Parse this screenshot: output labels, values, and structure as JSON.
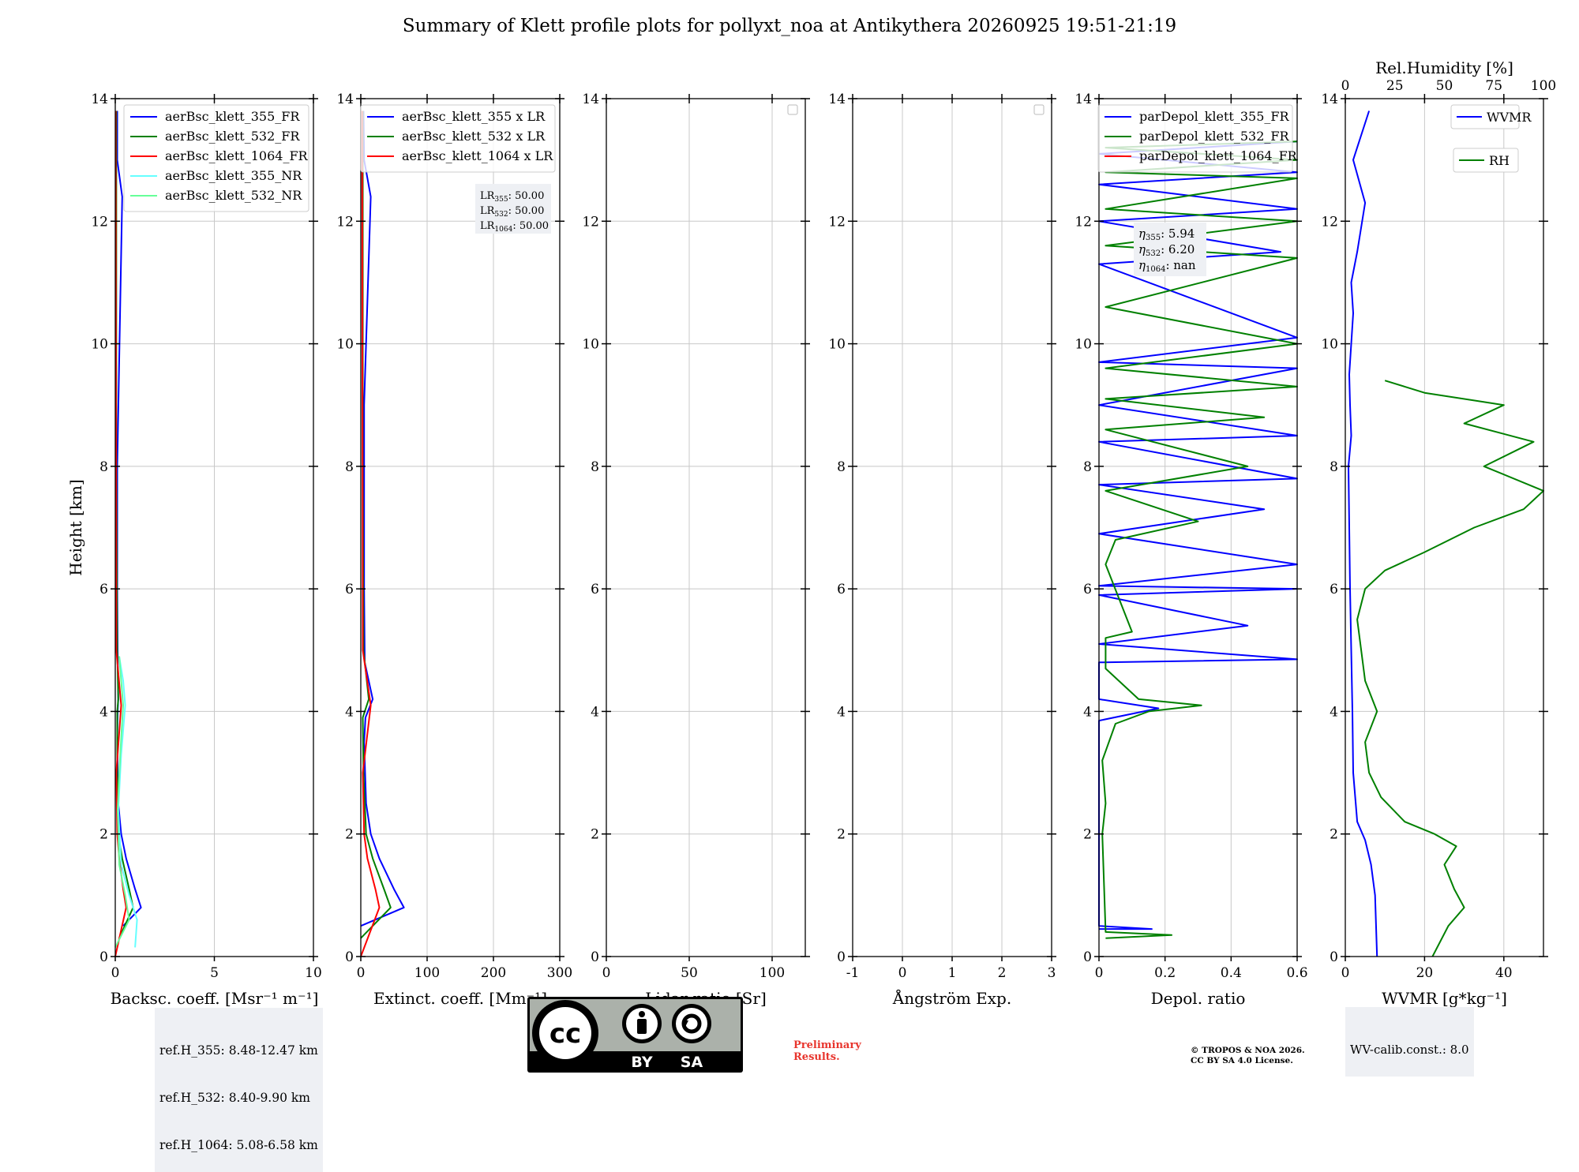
{
  "title": "Summary of Klett profile plots for pollyxt_noa at Antikythera 20260925 19:51-21:19",
  "colors": {
    "blue": "#0000ff",
    "green": "#008000",
    "red": "#ff0000",
    "cyan": "#66ffff",
    "lightgreen": "#66ff99",
    "prelim": "#e8352d"
  },
  "ref_box": [
    "ref.H_355: 8.48-12.47 km",
    "ref.H_532: 8.40-9.90 km",
    "ref.H_1064: 5.08-6.58 km"
  ],
  "lr_box": [
    "LR355: 50.00",
    "LR532: 50.00",
    "LR1064: 50.00"
  ],
  "eta_box": [
    "η355: 5.94",
    "η532: 6.20",
    "η1064: nan"
  ],
  "wv_calib": "WV-calib.const.: 8.0",
  "preliminary": [
    "Preliminary",
    "Results."
  ],
  "copyright": [
    "© TROPOS & NOA 2026.",
    "CC BY SA 4.0 License."
  ],
  "cc_logo": {
    "icons": [
      "cc-icon",
      "by-icon",
      "sa-icon"
    ],
    "labels": [
      "BY",
      "SA"
    ]
  },
  "chart_data": [
    {
      "type": "line",
      "id": "backscatter",
      "xlabel": "Backsc. coeff. [Msr⁻¹ m⁻¹]",
      "ylabel": "Height [km]",
      "xlim": [
        0,
        10
      ],
      "ylim": [
        0,
        14
      ],
      "xticks": [
        0,
        5,
        10
      ],
      "yticks": [
        0,
        2,
        4,
        6,
        8,
        10,
        12,
        14
      ],
      "grid": true,
      "legend": "top-right",
      "series": [
        {
          "name": "aerBsc_klett_355_FR",
          "color": "blue",
          "x": [
            0.4,
            1.3,
            1.0,
            0.55,
            0.3,
            0.15,
            0.1,
            0.12,
            0.15,
            0.12,
            0.1,
            0.1,
            0.35,
            0.1,
            0.1
          ],
          "y": [
            0.5,
            0.8,
            1.1,
            1.6,
            2.0,
            2.5,
            3.5,
            4.0,
            4.2,
            5.0,
            6.0,
            8.0,
            12.4,
            13.0,
            13.8
          ]
        },
        {
          "name": "aerBsc_klett_532_FR",
          "color": "green",
          "x": [
            0.2,
            0.9,
            0.7,
            0.35,
            0.15,
            0.1,
            0.1,
            0.15,
            0.1,
            0.05,
            0.05
          ],
          "y": [
            0.3,
            0.8,
            1.1,
            1.6,
            2.0,
            3.0,
            4.0,
            4.2,
            5.0,
            8.0,
            13.8
          ]
        },
        {
          "name": "aerBsc_klett_1064_FR",
          "color": "red",
          "x": [
            0.0,
            0.55,
            0.4,
            0.2,
            0.1,
            0.05,
            0.3,
            0.05,
            0.02
          ],
          "y": [
            0.0,
            0.8,
            1.1,
            1.6,
            2.0,
            3.0,
            4.1,
            5.0,
            13.8
          ]
        },
        {
          "name": "aerBsc_klett_355_NR",
          "color": "cyan",
          "x": [
            1.0,
            1.1,
            0.7,
            0.3,
            0.15,
            0.3,
            0.5,
            0.4,
            0.2
          ],
          "y": [
            0.15,
            0.6,
            1.0,
            1.5,
            2.4,
            3.3,
            4.1,
            4.5,
            4.9
          ]
        },
        {
          "name": "aerBsc_klett_532_NR",
          "color": "lightgreen",
          "x": [
            0.0,
            0.7,
            0.5,
            0.2,
            0.12,
            0.25,
            0.4,
            0.2
          ],
          "y": [
            0.15,
            0.6,
            1.0,
            1.5,
            2.4,
            3.3,
            4.1,
            4.9
          ]
        }
      ]
    },
    {
      "type": "line",
      "id": "extinction",
      "xlabel": "Extinct. coeff. [Mm⁻¹]",
      "xlim": [
        0,
        300
      ],
      "ylim": [
        0,
        14
      ],
      "xticks": [
        0,
        100,
        200,
        300
      ],
      "yticks": [
        0,
        2,
        4,
        6,
        8,
        10,
        12,
        14
      ],
      "grid": true,
      "legend": "top-right",
      "series": [
        {
          "name": "aerBsc_klett_355 x LR",
          "color": "blue",
          "x": [
            0,
            65,
            50,
            28,
            15,
            8,
            5,
            7,
            18,
            6,
            5,
            5,
            15,
            5,
            4
          ],
          "y": [
            0.5,
            0.8,
            1.1,
            1.6,
            2.0,
            2.5,
            3.5,
            3.9,
            4.2,
            4.8,
            6.0,
            9.0,
            12.4,
            13.0,
            13.8
          ]
        },
        {
          "name": "aerBsc_klett_532 x LR",
          "color": "green",
          "x": [
            0,
            45,
            35,
            18,
            8,
            4,
            3,
            12,
            4,
            3,
            3
          ],
          "y": [
            0.3,
            0.8,
            1.1,
            1.6,
            2.0,
            3.0,
            3.9,
            4.2,
            5.0,
            8.0,
            13.8
          ]
        },
        {
          "name": "aerBsc_klett_1064 x LR",
          "color": "red",
          "x": [
            0,
            28,
            22,
            10,
            5,
            3,
            15,
            3,
            2
          ],
          "y": [
            0.0,
            0.8,
            1.1,
            1.6,
            2.0,
            3.0,
            4.1,
            5.0,
            13.8
          ]
        }
      ]
    },
    {
      "type": "line",
      "id": "lidar-ratio",
      "xlabel": "Lidar ratio [Sr]",
      "xlim": [
        0,
        120
      ],
      "ylim": [
        0,
        14
      ],
      "xticks": [
        0,
        50,
        100
      ],
      "yticks": [
        0,
        2,
        4,
        6,
        8,
        10,
        12,
        14
      ],
      "grid": true,
      "legend": "top-right",
      "series": []
    },
    {
      "type": "line",
      "id": "angstrom",
      "xlabel": "Ångström Exp.",
      "xlim": [
        -1,
        3
      ],
      "ylim": [
        0,
        14
      ],
      "xticks": [
        -1,
        0,
        1,
        2,
        3
      ],
      "yticks": [
        0,
        2,
        4,
        6,
        8,
        10,
        12,
        14
      ],
      "grid": true,
      "legend": "top-right",
      "series": []
    },
    {
      "type": "line",
      "id": "depol",
      "xlabel": "Depol. ratio",
      "xlim": [
        0,
        0.6
      ],
      "ylim": [
        0,
        14
      ],
      "xticks": [
        0,
        0.2,
        0.4,
        0.6
      ],
      "yticks": [
        0,
        2,
        4,
        6,
        8,
        10,
        12,
        14
      ],
      "grid": true,
      "legend": "top-right",
      "series": [
        {
          "name": "parDepol_klett_355_FR",
          "color": "blue",
          "x": [
            0.0,
            0.16,
            0.0,
            0.0,
            0.18,
            0.0,
            0.0,
            0.6,
            0.0,
            0.45,
            0.0,
            0.6,
            0.0,
            0.6,
            0.0,
            0.5,
            0.0,
            0.6,
            0.0,
            0.6,
            0.0,
            0.6,
            0.0,
            0.6,
            0.0,
            0.55,
            0.0,
            0.6,
            0.0,
            0.6,
            0.0,
            0.6
          ],
          "y": [
            0.45,
            0.45,
            0.5,
            3.85,
            4.05,
            4.2,
            4.8,
            4.85,
            5.1,
            5.4,
            5.9,
            6.0,
            6.05,
            6.4,
            6.9,
            7.3,
            7.7,
            7.8,
            8.4,
            8.5,
            9.0,
            9.6,
            9.7,
            10.1,
            11.3,
            11.5,
            12.0,
            12.2,
            12.6,
            12.8,
            13.1,
            13.3
          ]
        },
        {
          "name": "parDepol_klett_532_FR",
          "color": "green",
          "x": [
            0.02,
            0.22,
            0.02,
            0.01,
            0.02,
            0.01,
            0.05,
            0.15,
            0.31,
            0.12,
            0.02,
            0.02,
            0.1,
            0.02,
            0.05,
            0.3,
            0.02,
            0.45,
            0.02,
            0.5,
            0.02,
            0.6,
            0.02,
            0.6,
            0.02,
            0.6,
            0.02,
            0.6,
            0.02,
            0.6,
            0.02,
            0.6,
            0.02,
            0.6
          ],
          "y": [
            0.3,
            0.35,
            0.4,
            2.0,
            2.5,
            3.2,
            3.8,
            4.0,
            4.1,
            4.2,
            4.7,
            5.2,
            5.3,
            6.4,
            6.8,
            7.1,
            7.6,
            8.0,
            8.6,
            8.8,
            9.1,
            9.3,
            9.6,
            10.0,
            10.6,
            11.4,
            11.6,
            12.0,
            12.2,
            12.7,
            12.8,
            13.0,
            13.2,
            13.3
          ]
        },
        {
          "name": "parDepol_klett_1064_FR",
          "color": "red",
          "x": [],
          "y": []
        }
      ]
    },
    {
      "type": "line",
      "id": "wvmr",
      "xlabel": "WVMR [g*kg⁻¹]",
      "xlabel2": "Rel.Humidity [%]",
      "xlim": [
        0,
        50
      ],
      "xlim2": [
        0,
        100
      ],
      "ylim": [
        0,
        14
      ],
      "xticks": [
        0,
        20,
        40
      ],
      "xticks2": [
        0,
        25,
        50,
        75,
        100
      ],
      "yticks": [
        0,
        2,
        4,
        6,
        8,
        10,
        12,
        14
      ],
      "grid": true,
      "legend": "top-right",
      "series": [
        {
          "name": "WVMR",
          "color": "blue",
          "axis": "bottom",
          "x": [
            8,
            7.5,
            6.5,
            5,
            3,
            2,
            1.8,
            1.5,
            1.2,
            1,
            0.8,
            1.5,
            1.2,
            1,
            2,
            1.5,
            3,
            5,
            2,
            6
          ],
          "y": [
            0,
            1,
            1.5,
            1.9,
            2.2,
            3,
            4,
            5,
            6,
            7,
            8,
            8.5,
            9,
            9.5,
            10.5,
            11,
            11.5,
            12.3,
            13,
            13.8
          ]
        },
        {
          "name": "RH",
          "color": "green",
          "axis": "top",
          "x": [
            44,
            52,
            60,
            55,
            50,
            56,
            45,
            30,
            18,
            12,
            10,
            16,
            10,
            8,
            6,
            10,
            20,
            40,
            65,
            90,
            100,
            70,
            95,
            60,
            80,
            40,
            30,
            20
          ],
          "y": [
            0.0,
            0.5,
            0.8,
            1.1,
            1.5,
            1.8,
            2.0,
            2.2,
            2.6,
            3.0,
            3.5,
            4.0,
            4.5,
            5.0,
            5.5,
            6.0,
            6.3,
            6.6,
            7.0,
            7.3,
            7.6,
            8.0,
            8.4,
            8.7,
            9.0,
            9.2,
            9.3,
            9.4
          ]
        }
      ]
    }
  ]
}
